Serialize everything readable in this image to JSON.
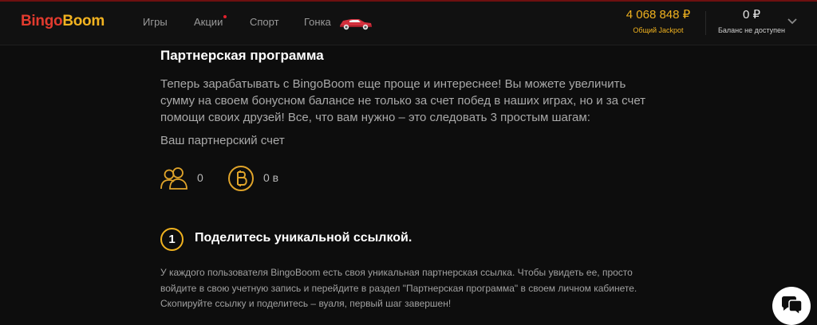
{
  "header": {
    "logo_part1": "Bingo",
    "logo_part2": "Boom",
    "nav": [
      {
        "label": "Игры"
      },
      {
        "label": "Акции"
      },
      {
        "label": "Спорт"
      },
      {
        "label": "Гонка"
      }
    ],
    "jackpot": {
      "amount": "4 068 848 ₽",
      "label": "Общий Jackpot"
    },
    "balance": {
      "amount": "0 ₽",
      "label": "Баланс не доступен"
    }
  },
  "main": {
    "title": "Партнерская программа",
    "intro": "Теперь зарабатывать с BingoBoom еще проще и интереснее! Вы можете увеличить сумму на своем бонусном балансе не только за счет побед в наших играх, но и за счет помощи своих друзей! Все, что вам нужно – это следовать 3 простым шагам:",
    "account_label": "Ваш партнерский счет",
    "referrals_count": "0",
    "coins_value": "0 в",
    "step": {
      "number": "1",
      "title": "Поделитесь уникальной ссылкой.",
      "text": "У каждого пользователя BingoBoom есть своя уникальная партнерская ссылка. Чтобы увидеть ее, просто войдите в свою учетную запись и перейдите в раздел \"Партнерская программа\" в своем личном кабинете. Скопируйте ссылку и поделитесь – вуаля, первый шаг завершен!"
    }
  },
  "colors": {
    "accent": "#f0b21f",
    "logo_red": "#e23b2e",
    "background": "#0d0d0d"
  },
  "icons": [
    "users-icon",
    "bonus-coin-icon",
    "race-car-icon",
    "chevron-down-icon",
    "chat-icon"
  ]
}
